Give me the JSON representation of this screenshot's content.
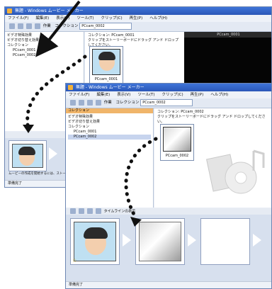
{
  "colors": {
    "titlebar": "#2a57b7",
    "collection_header": "#f0b56a",
    "dots": "#111111"
  },
  "window_back": {
    "title": "無題 - Windows ムービー メーカー",
    "menu": [
      "ファイル(F)",
      "編集(E)",
      "表示(V)",
      "ツール(T)",
      "クリップ(C)",
      "再生(P)",
      "ヘルプ(H)"
    ],
    "toolbar": {
      "task_label": "作業",
      "collection_label": "コレクション",
      "address": "PCcam_0002"
    },
    "tree": [
      "ビデオ特殊効果",
      "ビデオ切り替え効果",
      "コレクション",
      "PCcam_0001",
      "PCcam_0002"
    ],
    "collection_header": "コレクション: PCcam_0001",
    "collection_hint": "クリップをストーリーボードにドラッグ アンド ドロップしてください。",
    "preview_title": "PCcam_0001",
    "storyboard_hint": "ムービーの作成を開始するには、ストーリーボードにクリップをドラッグします。",
    "status": "準備完了"
  },
  "window_front": {
    "title": "無題 - Windows ムービー メーカー",
    "menu": [
      "ファイル(F)",
      "編集(E)",
      "表示(V)",
      "ツール(T)",
      "クリップ(C)",
      "再生(P)",
      "ヘルプ(H)"
    ],
    "toolbar": {
      "task_label": "作業",
      "collection_label": "コレクション",
      "address": "PCcam_0002"
    },
    "tree_header": "コレクション",
    "tree": [
      "ビデオ特殊効果",
      "ビデオ切り替え効果",
      "コレクション",
      "PCcam_0001",
      "PCcam_0002"
    ],
    "collection_header": "コレクション: PCcam_0002",
    "collection_hint": "クリップをストーリーボードにドラッグ アンド ドロップしてください。",
    "clip_label": "PCcam_0002",
    "storyboard_tool": "タイムラインの表示",
    "status": "準備完了"
  }
}
